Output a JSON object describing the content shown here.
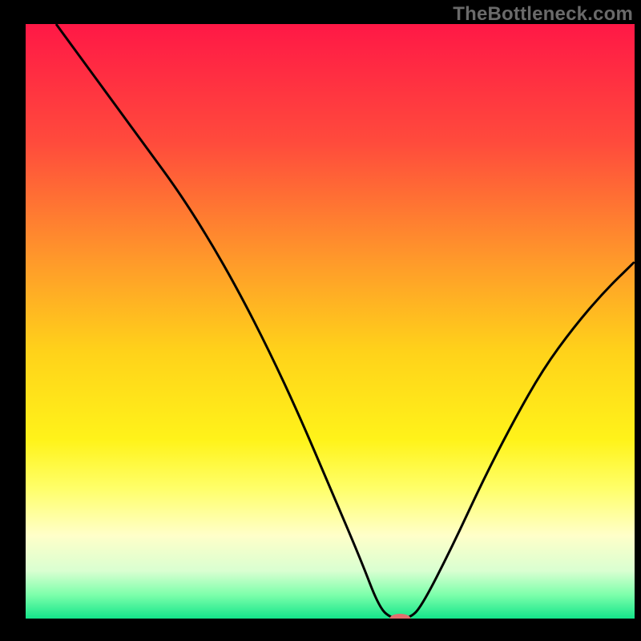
{
  "watermark": "TheBottleneck.com",
  "chart_data": {
    "type": "line",
    "title": "",
    "xlabel": "",
    "ylabel": "",
    "xlim": [
      0,
      100
    ],
    "ylim": [
      0,
      100
    ],
    "background": {
      "type": "vertical-gradient",
      "stops": [
        {
          "pos": 0,
          "color": "#ff1846"
        },
        {
          "pos": 20,
          "color": "#ff4b3c"
        },
        {
          "pos": 40,
          "color": "#ff9a2a"
        },
        {
          "pos": 55,
          "color": "#ffd21a"
        },
        {
          "pos": 70,
          "color": "#fff31a"
        },
        {
          "pos": 78,
          "color": "#ffff68"
        },
        {
          "pos": 86,
          "color": "#ffffc9"
        },
        {
          "pos": 92,
          "color": "#d9ffd1"
        },
        {
          "pos": 96,
          "color": "#7dffab"
        },
        {
          "pos": 100,
          "color": "#14e58a"
        }
      ]
    },
    "series": [
      {
        "name": "bottleneck-curve",
        "color": "#000000",
        "x": [
          5,
          10,
          15,
          20,
          25,
          30,
          35,
          40,
          45,
          50,
          55,
          58,
          60,
          63,
          65,
          70,
          75,
          80,
          85,
          90,
          95,
          100
        ],
        "y": [
          100,
          93,
          86,
          79,
          72,
          64,
          55,
          45,
          34,
          22,
          10,
          2,
          0,
          0,
          2,
          12,
          23,
          33,
          42,
          49,
          55,
          60
        ]
      }
    ],
    "marker": {
      "x": 61.5,
      "y": 0,
      "color": "#e26e6e",
      "rx": 13,
      "ry": 6
    }
  }
}
